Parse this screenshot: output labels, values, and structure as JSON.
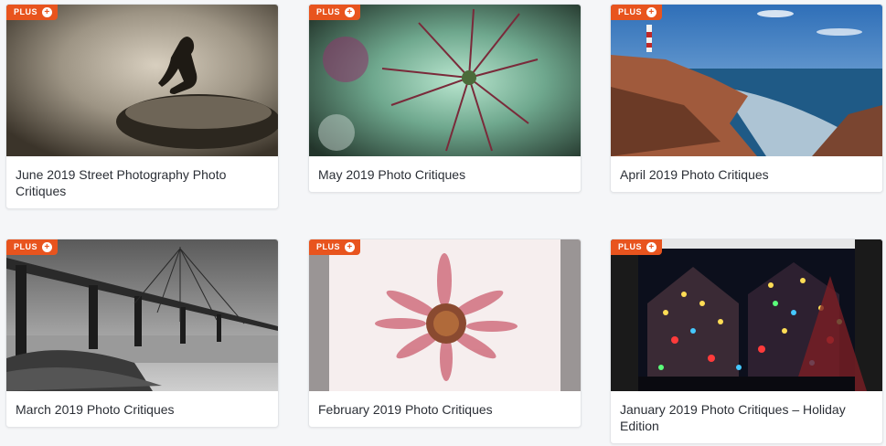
{
  "badge": {
    "label": "PLUS",
    "plus_symbol": "+"
  },
  "accent_color": "#e8541e",
  "cards": [
    {
      "title": "June 2019 Street Photography Photo Critiques",
      "image": "silhouette-girl-on-rock"
    },
    {
      "title": "May 2019 Photo Critiques",
      "image": "green-flower-closeup"
    },
    {
      "title": "April 2019 Photo Critiques",
      "image": "lighthouse-coastline"
    },
    {
      "title": "March 2019 Photo Critiques",
      "image": "bridge-black-and-white"
    },
    {
      "title": "February 2019 Photo Critiques",
      "image": "dried-pink-flower"
    },
    {
      "title": "January 2019 Photo Critiques – Holiday Edition",
      "image": "holiday-lights-house"
    }
  ]
}
